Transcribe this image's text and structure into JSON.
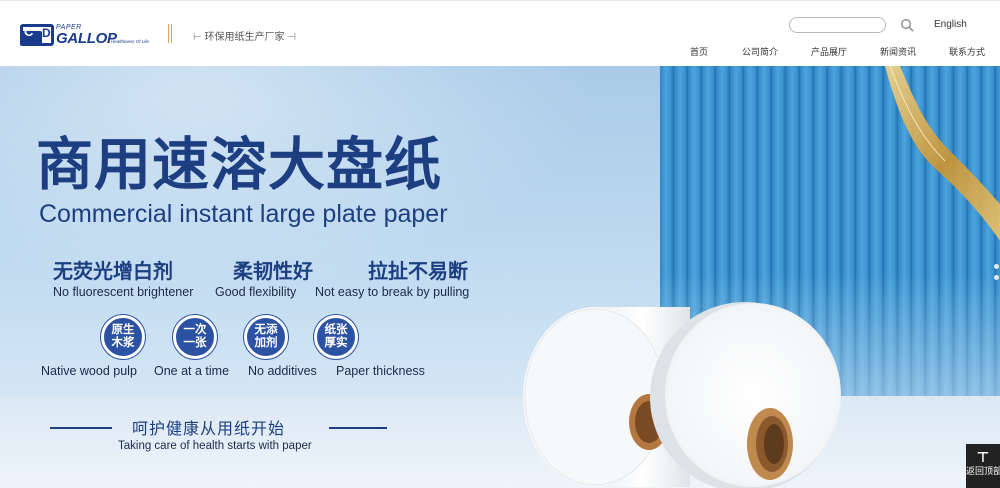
{
  "header": {
    "logo": {
      "mark_c": "C",
      "mark_d": "D",
      "paper": "PAPER",
      "brand": "GALLOP",
      "tagline": "Healthiness Of Life"
    },
    "slogan": "环保用纸生产厂家",
    "search": {
      "placeholder": "",
      "value": ""
    },
    "search_icon": "search-icon",
    "language": "English",
    "nav": [
      "首页",
      "公司简介",
      "产品展厅",
      "新闻资讯",
      "联系方式"
    ]
  },
  "banner": {
    "title_cn": "商用速溶大盘纸",
    "title_en": "Commercial instant large plate paper",
    "features": [
      {
        "cn": "无荧光增白剂",
        "en": "No fluorescent brightener"
      },
      {
        "cn": "柔韧性好",
        "en": "Good flexibility"
      },
      {
        "cn": "拉扯不易断",
        "en": "Not easy to break by pulling"
      }
    ],
    "badges": [
      {
        "cn": "原生木浆",
        "en": "Native wood pulp"
      },
      {
        "cn": "一次一张",
        "en": "One at a time"
      },
      {
        "cn": "无添加剂",
        "en": "No additives"
      },
      {
        "cn": "纸张厚实",
        "en": "Paper thickness"
      }
    ],
    "slogan_cn": "呵护健康从用纸开始",
    "slogan_en": "Taking care of health starts with paper",
    "colors": {
      "primary": "#1d3f82",
      "badge": "#2c52a4",
      "stripes": "#2f86c4",
      "gold": "#d7a75a"
    }
  },
  "back_to_top": {
    "icon": "arrow-up-icon",
    "label": "返回顶部"
  }
}
